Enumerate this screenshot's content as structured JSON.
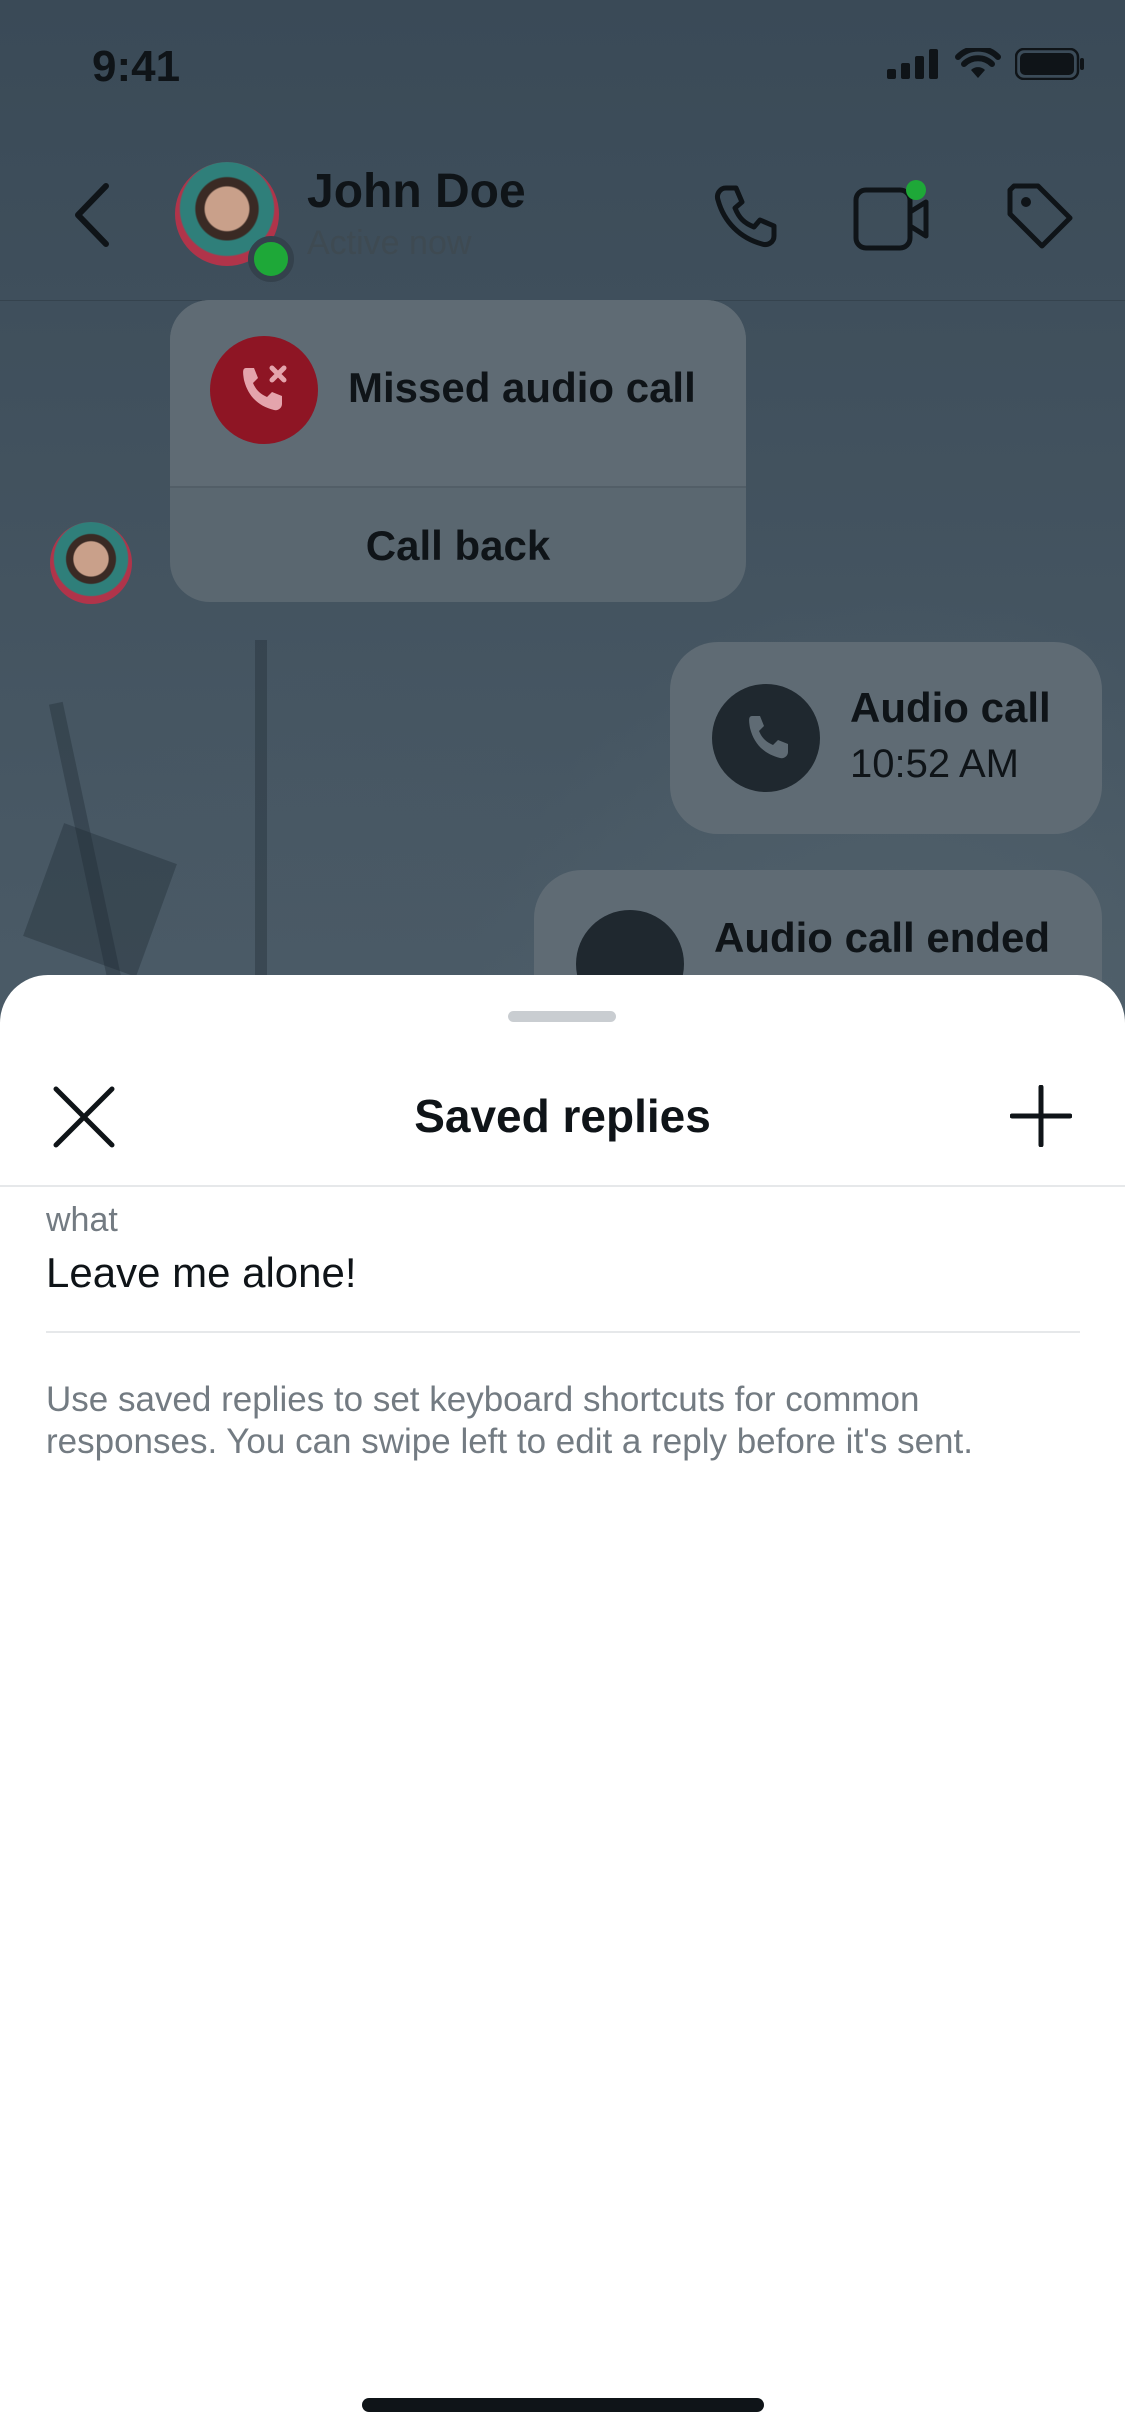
{
  "status_bar": {
    "time": "9:41"
  },
  "header": {
    "contact_name": "John Doe",
    "status": "Active now"
  },
  "chat": {
    "missed_call": {
      "label": "Missed audio call",
      "action": "Call back"
    },
    "audio_call": {
      "label": "Audio call",
      "time": "10:52 AM"
    },
    "call_ended": {
      "label": "Audio call ended"
    }
  },
  "sheet": {
    "title": "Saved replies",
    "items": [
      {
        "shortcut": "what",
        "message": "Leave me alone!"
      }
    ],
    "hint": "Use saved replies to set keyboard shortcuts for common responses. You can swipe left to edit a reply before it's sent."
  },
  "colors": {
    "missed_call_red": "#d0273d",
    "online_green": "#1ea838",
    "sheet_bg": "#ffffff"
  }
}
